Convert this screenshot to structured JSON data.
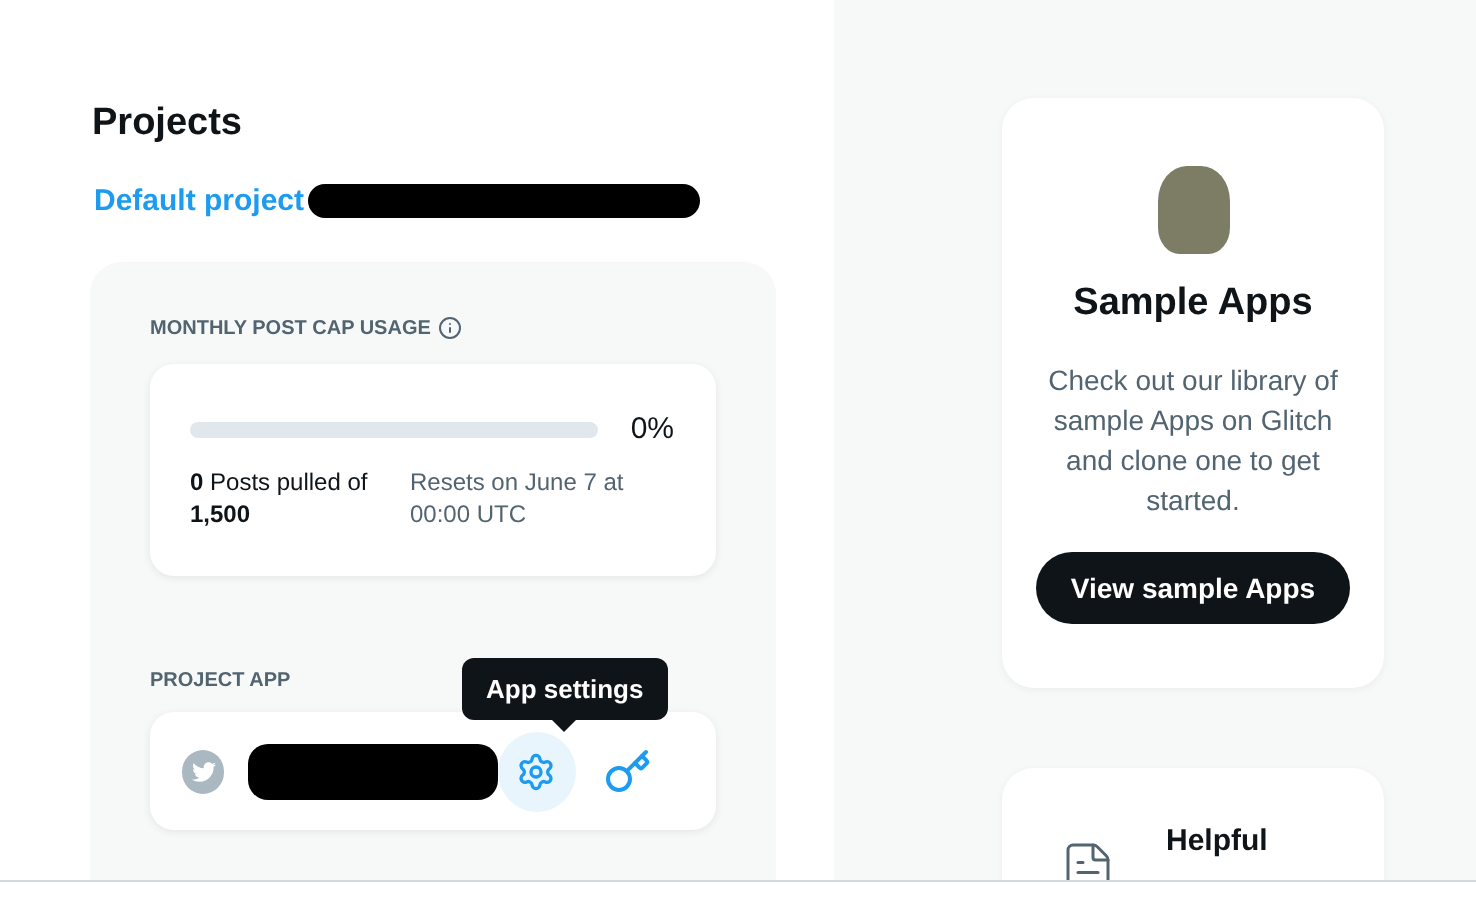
{
  "projects_title": "Projects",
  "default_project": {
    "label": "Default project"
  },
  "usage": {
    "label": "MONTHLY POST CAP USAGE",
    "level": 0,
    "percent": "0%",
    "posts": "**0** Posts pulled of **1,500**",
    "resets": "Resets on June 7 at 00:00 UTC"
  },
  "project_app": {
    "label": "PROJECT APP",
    "tooltip": "App settings"
  },
  "sample_apps": {
    "title": "Sample Apps",
    "description": "Check out our library of sample Apps on Glitch and clone one to get started.",
    "button": "View sample Apps"
  },
  "helpful_card": {
    "title": "Helpful"
  }
}
